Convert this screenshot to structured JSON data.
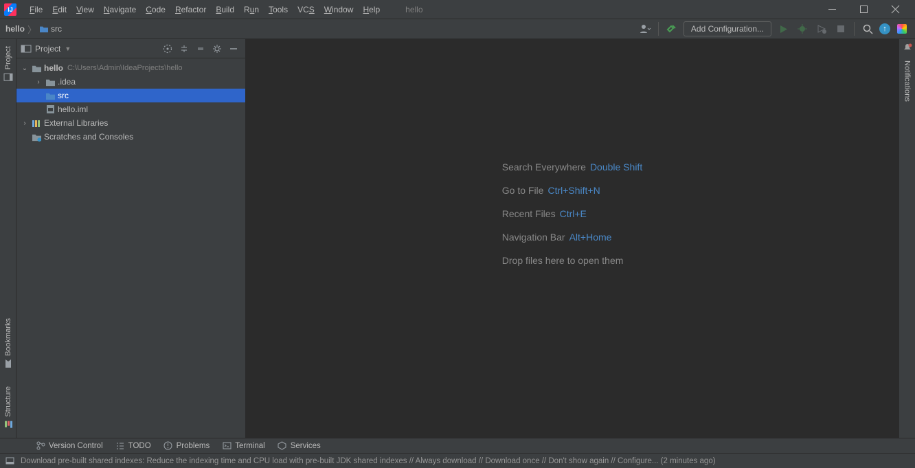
{
  "window_title": "hello",
  "menu": [
    "File",
    "Edit",
    "View",
    "Navigate",
    "Code",
    "Refactor",
    "Build",
    "Run",
    "Tools",
    "VCS",
    "Window",
    "Help"
  ],
  "menu_underline_index": [
    0,
    0,
    0,
    0,
    0,
    0,
    0,
    0,
    0,
    0,
    0,
    0
  ],
  "breadcrumb": {
    "root": "hello",
    "child": "src"
  },
  "toolbar": {
    "add_config": "Add Configuration..."
  },
  "project_panel": {
    "title": "Project",
    "tree": {
      "root_name": "hello",
      "root_path": "C:\\Users\\Admin\\IdeaProjects\\hello",
      "idea_dir": ".idea",
      "src_dir": "src",
      "iml_file": "hello.iml",
      "external_libs": "External Libraries",
      "scratches": "Scratches and Consoles"
    }
  },
  "left_stripe": {
    "project": "Project",
    "structure": "Structure",
    "bookmarks": "Bookmarks"
  },
  "right_stripe": {
    "notifications": "Notifications"
  },
  "empty_editor": {
    "rows": [
      {
        "label": "Search Everywhere",
        "shortcut": "Double Shift"
      },
      {
        "label": "Go to File",
        "shortcut": "Ctrl+Shift+N"
      },
      {
        "label": "Recent Files",
        "shortcut": "Ctrl+E"
      },
      {
        "label": "Navigation Bar",
        "shortcut": "Alt+Home"
      }
    ],
    "drop_hint": "Drop files here to open them"
  },
  "bottom_tools": {
    "version_control": "Version Control",
    "todo": "TODO",
    "problems": "Problems",
    "terminal": "Terminal",
    "services": "Services"
  },
  "statusbar": {
    "message": "Download pre-built shared indexes: Reduce the indexing time and CPU load with pre-built JDK shared indexes // Always download // Download once // Don't show again // Configure... (2 minutes ago)"
  }
}
